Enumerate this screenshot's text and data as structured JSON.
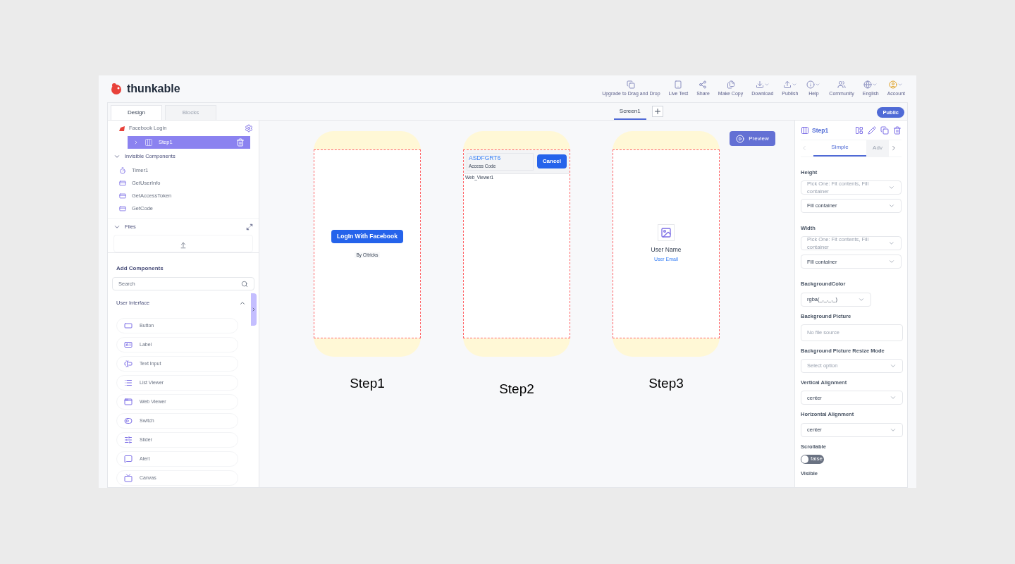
{
  "app": {
    "logo": "thunkable"
  },
  "toolbar": [
    {
      "label": "Upgrade to Drag and Drop",
      "dropdown": false
    },
    {
      "label": "Live Test",
      "dropdown": false
    },
    {
      "label": "Share",
      "dropdown": false
    },
    {
      "label": "Make Copy",
      "dropdown": false
    },
    {
      "label": "Download",
      "dropdown": true
    },
    {
      "label": "Publish",
      "dropdown": true
    },
    {
      "label": "Help",
      "dropdown": true
    },
    {
      "label": "Community",
      "dropdown": false
    },
    {
      "label": "English",
      "dropdown": true
    },
    {
      "label": "Account",
      "dropdown": true
    }
  ],
  "tabs": [
    {
      "label": "Design",
      "selected": true
    },
    {
      "label": "Blocks",
      "selected": false
    }
  ],
  "screen_tab": {
    "label": "Screen1",
    "selected": true
  },
  "public_badge": "Public",
  "tree": {
    "screen": "Facebook Login",
    "selected_item": {
      "label": "Step1",
      "selected": true
    },
    "invisible": {
      "title": "Invisible Components",
      "expanded": true,
      "items": [
        "Timer1",
        "GetUserInfo",
        "GetAccessToken",
        "GetCode"
      ]
    },
    "files": {
      "title": "Files",
      "expanded": true
    }
  },
  "add_components": {
    "title": "Add Components",
    "search_placeholder": "Search",
    "section": "User Interface",
    "expanded": true,
    "items": [
      "Button",
      "Label",
      "Text Input",
      "List Viewer",
      "Web Viewer",
      "Switch",
      "Slider",
      "Alert",
      "Canvas"
    ]
  },
  "preview_button": "Preview",
  "phones": [
    {
      "kind": "login",
      "caption": "Step1",
      "button": "LogIn With Facebook",
      "credit": "By Cttricks"
    },
    {
      "kind": "access",
      "caption": "Step2",
      "code": "ASDFGRT6",
      "code_label": "Access Code",
      "cancel": "Cancel",
      "viewer": "Web_Viewer1"
    },
    {
      "kind": "profile",
      "caption": "Step3",
      "name": "User Name",
      "email": "User Email"
    }
  ],
  "properties": {
    "title": "Step1",
    "tabs": [
      {
        "label": "Simple",
        "selected": true
      },
      {
        "label": "Adv",
        "selected": false
      }
    ],
    "items": [
      {
        "kind": "size",
        "label": "Height",
        "placeholder": "Pick One: Fit contents, Fill container",
        "value": "Fill container"
      },
      {
        "kind": "size",
        "label": "Width",
        "placeholder": "Pick One: Fit contents, Fill container",
        "value": "Fill container"
      },
      {
        "kind": "color",
        "label": "BackgroundColor",
        "value": "rgba(_,_,_,_)"
      },
      {
        "kind": "file",
        "label": "Background Picture",
        "placeholder": "No file source"
      },
      {
        "kind": "select",
        "label": "Background Picture Resize Mode",
        "placeholder": "Select option"
      },
      {
        "kind": "select",
        "label": "Vertical Alignment",
        "value": "center"
      },
      {
        "kind": "select",
        "label": "Horizontal Alignment",
        "value": "center"
      },
      {
        "kind": "toggle",
        "label": "Scrollable",
        "on": false,
        "value": "false"
      },
      {
        "kind": "heading",
        "label": "Visible"
      }
    ]
  }
}
